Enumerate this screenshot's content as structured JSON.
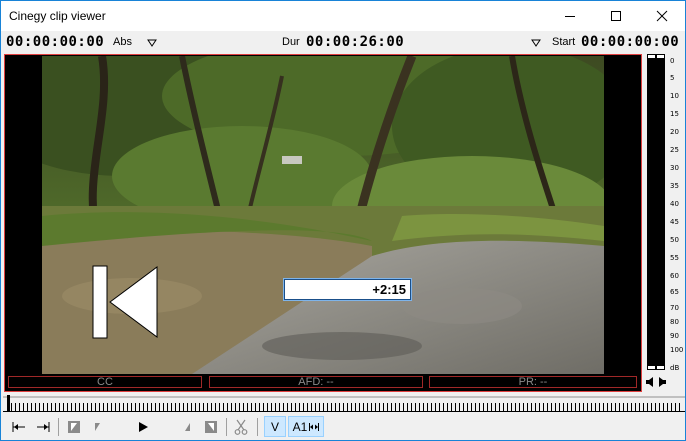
{
  "window": {
    "title": "Cinegy clip viewer",
    "accent": "#1883d7"
  },
  "timecodes": {
    "position": "00:00:00:00",
    "position_mode": "Abs",
    "duration_label": "Dur",
    "duration": "00:00:26:00",
    "start_label": "Start",
    "start": "00:00:00:00"
  },
  "video": {
    "seek_input_value": "+2:15",
    "overlay_icon": "skip-to-start-icon",
    "status": {
      "cc": "CC",
      "afd": "AFD: --",
      "pr": "PR: --"
    },
    "frame_border_color": "#e04040"
  },
  "audio_meter": {
    "scale": [
      "0",
      "5",
      "10",
      "15",
      "20",
      "25",
      "30",
      "35",
      "40",
      "45",
      "50",
      "55",
      "60",
      "65",
      "70",
      "80",
      "90",
      "100",
      "dB"
    ],
    "mute_icon": "speaker-icon"
  },
  "timeline": {
    "playhead_position": 0
  },
  "toolbar": {
    "buttons": [
      {
        "name": "go-to-start",
        "icon": "go-to-start-icon"
      },
      {
        "name": "go-to-end",
        "icon": "go-to-end-icon"
      },
      {
        "name": "mark-in",
        "icon": "mark-in-icon"
      },
      {
        "name": "prev-mark",
        "icon": "prev-mark-icon"
      },
      {
        "name": "play",
        "icon": "play-icon"
      },
      {
        "name": "next-mark",
        "icon": "next-mark-icon"
      },
      {
        "name": "mark-out",
        "icon": "mark-out-icon"
      },
      {
        "name": "cut",
        "icon": "scissors-icon"
      }
    ],
    "video_toggle": "V",
    "audio_toggle": "A1"
  }
}
